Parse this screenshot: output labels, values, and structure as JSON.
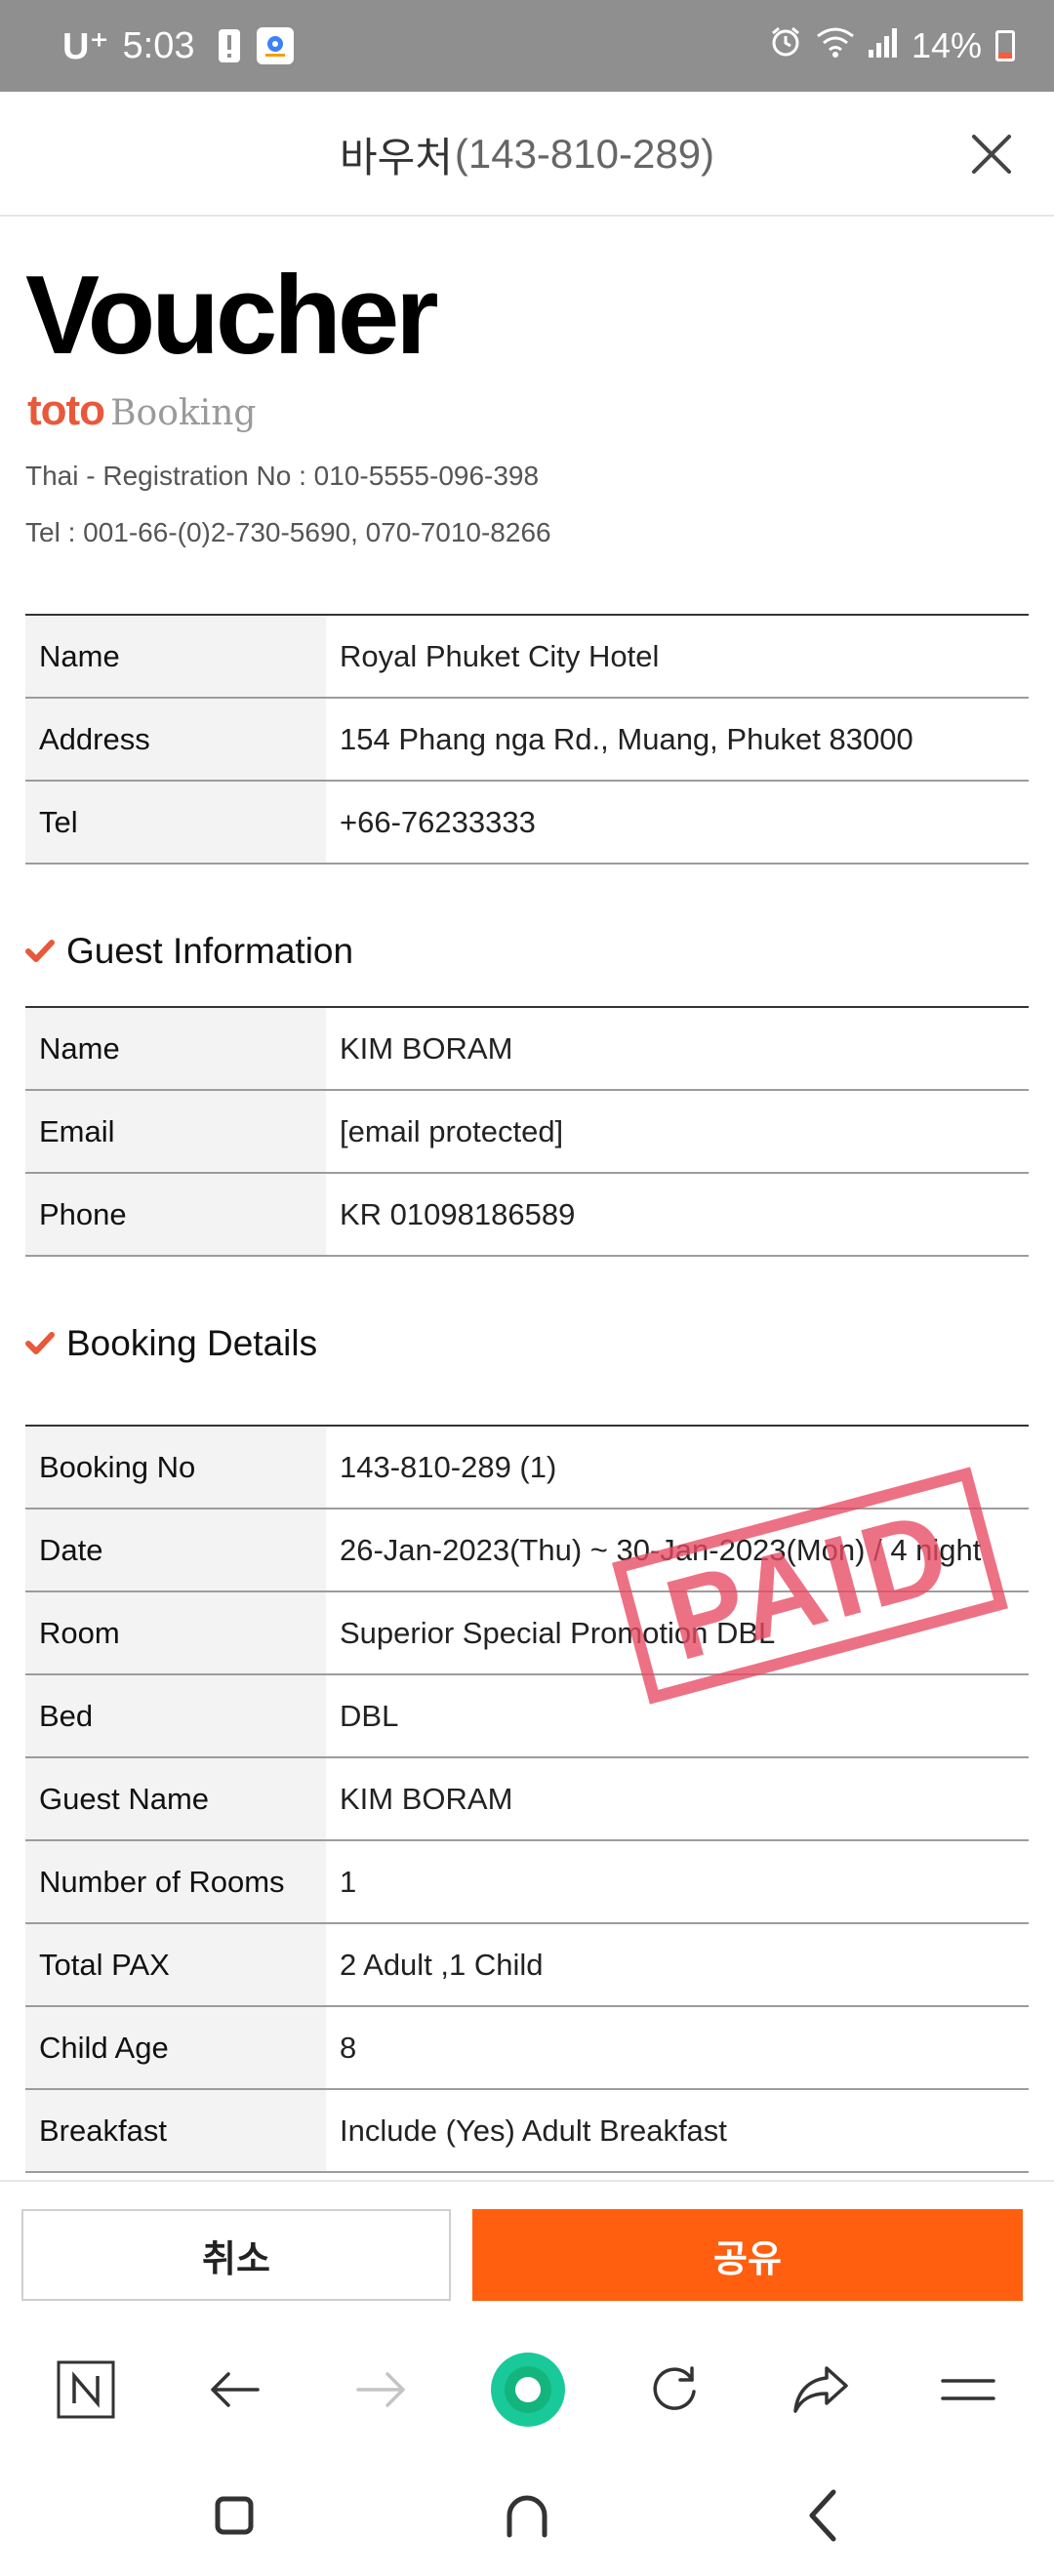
{
  "status_bar": {
    "carrier": "U⁺",
    "time": "5:03",
    "battery": "14%",
    "icons": [
      "alert-icon",
      "app-icon",
      "alarm-icon",
      "wifi-icon",
      "signal-icon",
      "battery-icon"
    ]
  },
  "header": {
    "title_prefix": "바우처",
    "title_number": "(143-810-289)",
    "close_icon": "close-icon"
  },
  "voucher": {
    "heading": "Voucher",
    "brand_name": "toto",
    "brand_suffix": "Booking",
    "registration": "Thai - Registration No : 010-5555-096-398",
    "tel": "Tel : 001-66-(0)2-730-5690, 070-7010-8266"
  },
  "hotel": [
    {
      "label": "Name",
      "value": "Royal Phuket City Hotel"
    },
    {
      "label": "Address",
      "value": "154 Phang nga Rd., Muang, Phuket 83000"
    },
    {
      "label": "Tel",
      "value": "+66-76233333"
    }
  ],
  "guest_section": {
    "title": "Guest Information",
    "rows": [
      {
        "label": "Name",
        "value": "KIM BORAM"
      },
      {
        "label": "Email",
        "value": "[email protected]"
      },
      {
        "label": "Phone",
        "value": "KR 01098186589"
      }
    ]
  },
  "booking_section": {
    "title": "Booking Details",
    "rows": [
      {
        "label": "Booking No",
        "value": "143-810-289 (1)"
      },
      {
        "label": "Date",
        "value": "26-Jan-2023(Thu) ~ 30-Jan-2023(Mon) / 4 night"
      },
      {
        "label": "Room",
        "value": "Superior Special Promotion DBL"
      },
      {
        "label": "Bed",
        "value": "DBL"
      },
      {
        "label": "Guest Name",
        "value": "KIM BORAM"
      },
      {
        "label": "Number of Rooms",
        "value": "1"
      },
      {
        "label": "Total PAX",
        "value": "2 Adult ,1 Child"
      },
      {
        "label": "Child Age",
        "value": "8"
      },
      {
        "label": "Breakfast",
        "value": "Include (Yes) Adult Breakfast"
      }
    ]
  },
  "stamp": "PAID",
  "actions": {
    "cancel_label": "취소",
    "share_label": "공유"
  },
  "colors": {
    "accent": "#ff5f0f",
    "stamp": "#e84a62",
    "check": "#e8583a",
    "brand": "#e8583a",
    "whale": "#19c99a"
  }
}
